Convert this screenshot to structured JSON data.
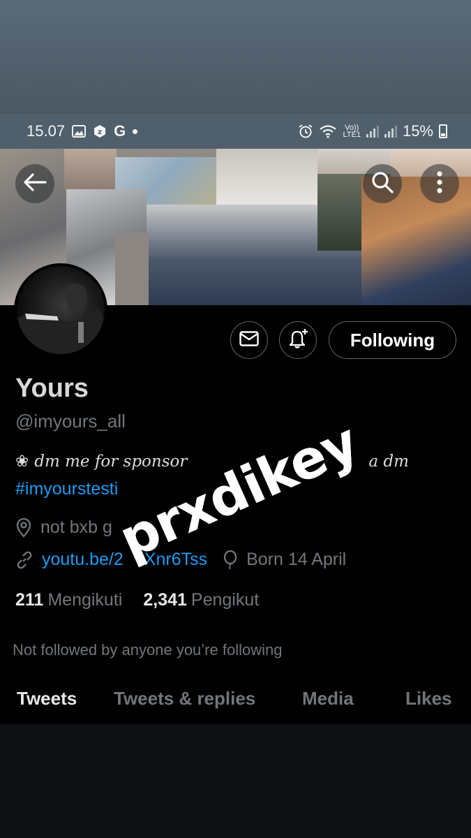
{
  "status_bar": {
    "time": "15.07",
    "g_icon_label": "G",
    "battery_percent": "15%",
    "network_label_top": "Vo))",
    "network_label_bottom": "LTE1"
  },
  "profile": {
    "display_name": "Yours",
    "handle": "@imyours_all",
    "bio_visible_start": "dm me for sponsor",
    "bio_visible_end": "a dm",
    "hashtag": "#imyourstesti",
    "location": "not bxb g",
    "link": "youtu.be/2",
    "link_tail": "Xnr6Tss",
    "birthday": "Born 14 April",
    "following_count": "211",
    "following_label": "Mengikuti",
    "followers_count": "2,341",
    "followers_label": "Pengikut",
    "followed_by_note": "Not followed by anyone you’re following"
  },
  "actions": {
    "following_button": "Following"
  },
  "tabs": {
    "tweets": "Tweets",
    "replies": "Tweets & replies",
    "media": "Media",
    "likes": "Likes"
  },
  "sticker": {
    "text": "prxdikey"
  },
  "icons": {
    "back": "arrow-left-icon",
    "search": "search-icon",
    "more": "more-vertical-icon",
    "dm": "envelope-icon",
    "notify": "bell-plus-icon",
    "location": "location-pin-icon",
    "link": "link-icon",
    "birthday": "balloon-icon"
  },
  "colors": {
    "link_blue": "#1d9bf0",
    "muted": "#71767b",
    "background": "#000000"
  }
}
